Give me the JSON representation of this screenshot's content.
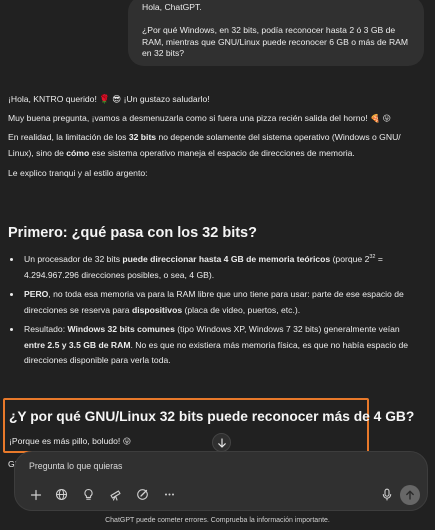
{
  "user_message": {
    "greeting": "Hola, ChatGPT.",
    "question_line1": "¿Por qué Windows, en 32 bits, podía reconocer hasta 2 ó 3 GB de",
    "question_line2": "RAM, mientras que GNU/Linux puede reconocer 6 GB o más de RAM",
    "question_line3": "en 32 bits?"
  },
  "assistant": {
    "greeting": "¡Hola, KNTRO querido! 🌹 😎 ¡Un gustazo saludarlo!",
    "intro_prefix": "Muy buena pregunta, ¡vamos a desmenuzarla como si fuera una pizza recién salida del horno! ",
    "intro_emoji": "🍕 😛",
    "p2_part1": "En realidad, la limitación de los ",
    "p2_bold1": "32 bits",
    "p2_part2": " no depende solamente del sistema operativo (Windows o GNU/",
    "p2_line2_part1": "Linux), sino de ",
    "p2_bold2": "cómo",
    "p2_line2_part2": " ese sistema operativo maneja el espacio de direcciones de memoria.",
    "p3": "Le explico tranqui y al estilo argento:",
    "section1_title": "Primero: ¿qué pasa con los 32 bits?",
    "b1_part1": "Un procesador de 32 bits ",
    "b1_bold": "puede direccionar hasta 4 GB de memoria teóricos",
    "b1_part2": " (porque 2",
    "b1_sup": "32",
    "b1_part3": " =",
    "b1_line2": "4.294.967.296 direcciones posibles, o sea, 4 GB).",
    "b2_bold": "PERO",
    "b2_part1": ", no toda esa memoria va para la RAM libre que uno tiene para usar: parte de ese espacio de",
    "b2_line2_part1": "direcciones se reserva para ",
    "b2_bold2": "dispositivos",
    "b2_line2_part2": " (placa de video, puertos, etc.).",
    "b3_part1": "Resultado: ",
    "b3_bold1": "Windows 32 bits comunes",
    "b3_part2": " (tipo Windows XP, Windows 7 32 bits) generalmente veían",
    "b3_bold2": "entre 2.5 y 3.5 GB de RAM",
    "b3_line2_part": ". No es que no existiera más memoria física, es que no había espacio de",
    "b3_line3": "direcciones disponible para verla toda.",
    "section2_title": "¿Y por qué GNU/Linux 32 bits puede reconocer más de 4 GB?",
    "section2_text": "¡Porque es más pillo, boludo! ",
    "section2_emoji": "😛",
    "cut_text": "GN"
  },
  "composer": {
    "placeholder": "Pregunta lo que quieras"
  },
  "footer": "ChatGPT puede cometer errores. Comprueba la información importante.",
  "icons": [
    "arrow-down-icon",
    "plus-icon",
    "globe-icon",
    "lightbulb-icon",
    "telescope-icon",
    "paintbrush-icon",
    "more-icon",
    "mic-icon",
    "send-arrow-icon"
  ]
}
